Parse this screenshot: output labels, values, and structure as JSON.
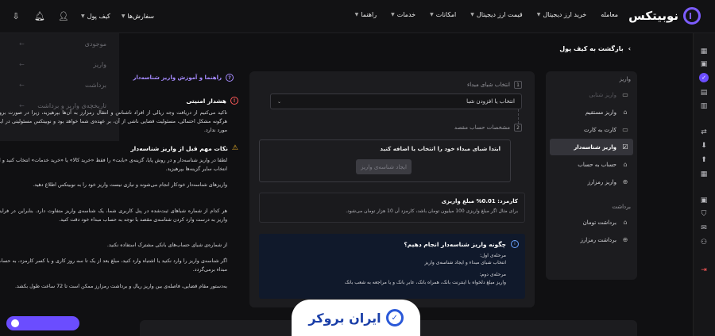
{
  "brand": {
    "name": "نوبیتکس",
    "accent": "#7c5cff"
  },
  "nav": [
    {
      "label": "معامله",
      "has_chevron": false
    },
    {
      "label": "خرید ارز دیجیتال",
      "has_chevron": true
    },
    {
      "label": "قیمت ارز دیجیتال",
      "has_chevron": true
    },
    {
      "label": "امکانات",
      "has_chevron": true
    },
    {
      "label": "خدمات",
      "has_chevron": true
    },
    {
      "label": "راهنما",
      "has_chevron": true
    }
  ],
  "topbar": {
    "wallet_label": "کیف پول",
    "services_label": "سفارش‌ها"
  },
  "wallet_dropdown": [
    {
      "label": "موجودی"
    },
    {
      "label": "واریز"
    },
    {
      "label": "برداشت"
    },
    {
      "label": "تاریخچه‌ی واریز و برداشت"
    }
  ],
  "back_link": "بازگشت به کیف پول",
  "side_menu": {
    "deposit_section": "واریز",
    "deposit_items": [
      {
        "label": "واریز شتابی",
        "icon": "card-icon",
        "state": "disabled"
      },
      {
        "label": "واریز مستقیم",
        "icon": "bank-icon",
        "state": "normal"
      },
      {
        "label": "کارت به کارت",
        "icon": "card-icon",
        "state": "normal"
      },
      {
        "label": "واریز شناسه‌دار",
        "icon": "id-icon",
        "state": "active"
      },
      {
        "label": "حساب به حساب",
        "icon": "bank-icon",
        "state": "normal"
      },
      {
        "label": "واریز رمزارز",
        "icon": "crypto-icon",
        "state": "normal"
      }
    ],
    "withdraw_section": "برداشت",
    "withdraw_items": [
      {
        "label": "برداشت تومان",
        "icon": "bank-icon"
      },
      {
        "label": "برداشت رمزارز",
        "icon": "crypto-icon"
      }
    ]
  },
  "form": {
    "step1_num": "1",
    "step1_label": "انتخاب شبای مبداء",
    "select_value": "انتخاب یا افزودن شبا",
    "step2_num": "2",
    "step2_label": "مشخصات حساب مقصد",
    "id_box_title": "ابتدا شبای مبداء خود را انتخاب یا اضافه کنید",
    "id_button": "ایجاد شناسه‌ی واریز",
    "fee_title": "کارمزد: 0.01% مبلغ واریزی",
    "fee_desc": "برای مثال اگر مبلغ واریزی 100 میلیون تومان باشد، کارمزد آن 10 هزار تومان می‌شود.",
    "how_title": "چگونه واریز شناسه‌دار انجام دهیم؟",
    "how_step1_title": "مرحله‌ی اول:",
    "how_step1_text": "انتخاب شبای مبداء و ایجاد شناسه‌ی واریز",
    "how_step2_title": "مرحله‌ی دوم:",
    "how_step2_text": "واریز مبلغ دلخواه با اینترنت بانک، همراه بانک، عابر بانک و یا مراجعه به شعب بانک"
  },
  "info": {
    "guide_link": "راهنما و آموزش واریز شناسه‌دار",
    "security_title": "هشدار امنیتی",
    "security_text": "تاکید می‌کنیم از دریافت وجه ریالی از افراد ناشناس و انتقال رمزارز به آن‌ها بپرهیزید، زیرا در صورت بروز هرگونه مشکل احتمالی، مسئولیت قضایی ناشی از آن، بر عهده‌ی شما خواهد بود و نوبیتکس مسئولیتی در این مورد ندارد.",
    "notes_title": "نکات مهم قبل از واریز شناسه‌دار",
    "notes": [
      "لطفا در واریز شناسه‌دار و در روش پایا، گزینه‌ی «بابت» را فقط «خرید کالا» یا «خرید خدمات» انتخاب کنید و از انتخاب سایر گزینه‌ها بپرهیزید.",
      "واریزهای شناسه‌دار خودکار انجام می‌شوند و نیازی نیست واریز خود را به نوبیتکس اطلاع دهید.",
      "هر کدام از شماره شباهای ثبت‌شده در پنل کاربری شما، یک شناسه‌ی واریز متفاوت دارد. بنابراین در فرایند واریز به درست وارد کردن شناسه‌ی مقصد با توجه به حساب مبداء خود دقت کنید.",
      "از شماره‌ی شبای حساب‌های بانکی مشترک استفاده نکنید.",
      "اگر شناسه‌ی واریز را وارد نکنید یا اشتباه وارد کنید، مبلغ بعد از یک تا سه روز کاری و با کسر کارمزد، به حساب مبداء برمی‌گردد.",
      "به‌دستور مقام قضایی، فاصله‌ی بین واریز ریال و برداشت رمزارز ممکن است تا 72 ساعت طول بکشد."
    ]
  },
  "watermark": {
    "text": "ایران بروکر"
  }
}
